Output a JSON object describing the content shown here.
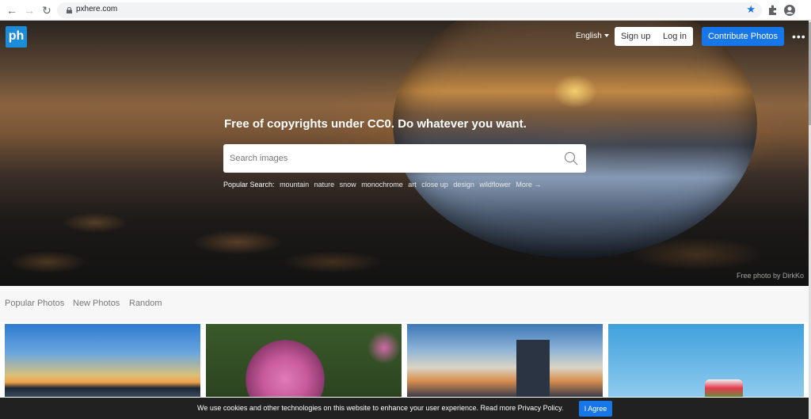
{
  "browser": {
    "url": "pxhere.com",
    "icons": [
      "back-icon",
      "forward-icon",
      "reload-icon",
      "lock-icon",
      "star-icon",
      "extensions-icon",
      "profile-icon"
    ]
  },
  "header": {
    "logo_text": "ph",
    "language": "English",
    "signup_label": "Sign up",
    "login_label": "Log in",
    "contribute_label": "Contribute Photos",
    "more_label": "•••",
    "accent_color": "#1877e8"
  },
  "hero": {
    "tagline": "Free of copyrights under CC0. Do whatever you want.",
    "search_placeholder": "Search images",
    "popular_label": "Popular Search:",
    "popular_tags": [
      "mountain",
      "nature",
      "snow",
      "monochrome",
      "art",
      "close up",
      "design",
      "wildflower",
      "More →"
    ],
    "credit": "Free photo by DirkKo"
  },
  "tabs": [
    "Popular Photos",
    "New Photos",
    "Random"
  ],
  "cookie": {
    "text": "We use cookies and other technologies on this website to enhance your user experience. Read more Privacy Policy.",
    "agree_label": "I Agree"
  }
}
